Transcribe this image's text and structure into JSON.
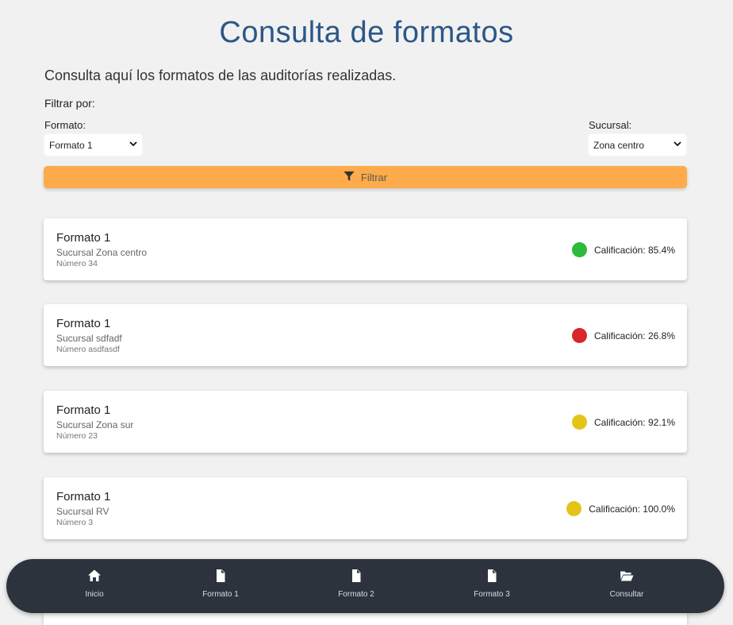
{
  "header": {
    "title": "Consulta de formatos",
    "subtitle": "Consulta aquí los formatos de las auditorías realizadas."
  },
  "filters": {
    "heading": "Filtrar por:",
    "formato": {
      "label": "Formato:",
      "selected": "Formato 1"
    },
    "sucursal": {
      "label": "Sucursal:",
      "selected": "Zona centro"
    },
    "button_label": "Filtrar",
    "button_icon": "filter-icon",
    "button_color": "#fdab4b"
  },
  "results": [
    {
      "title": "Formato 1",
      "branch": "Sucursal Zona centro",
      "number": "Número 34",
      "score": "Calificación: 85.4%",
      "status_color": "#2dbb3a"
    },
    {
      "title": "Formato 1",
      "branch": "Sucursal sdfadf",
      "number": "Número asdfasdf",
      "score": "Calificación: 26.8%",
      "status_color": "#d9262b"
    },
    {
      "title": "Formato 1",
      "branch": "Sucursal Zona sur",
      "number": "Número 23",
      "score": "Calificación: 92.1%",
      "status_color": "#e3c519"
    },
    {
      "title": "Formato 1",
      "branch": "Sucursal RV",
      "number": "Número 3",
      "score": "Calificación: 100.0%",
      "status_color": "#e3c519"
    }
  ],
  "nav": {
    "items": [
      {
        "label": "Inicio",
        "icon": "home-icon"
      },
      {
        "label": "Formato 1",
        "icon": "file-icon"
      },
      {
        "label": "Formato 2",
        "icon": "file-icon"
      },
      {
        "label": "Formato 3",
        "icon": "file-icon"
      },
      {
        "label": "Consultar",
        "icon": "folder-open-icon"
      }
    ],
    "background": "#2c333d"
  },
  "colors": {
    "title": "#2c5787",
    "page_background": "#f1f1f1"
  }
}
